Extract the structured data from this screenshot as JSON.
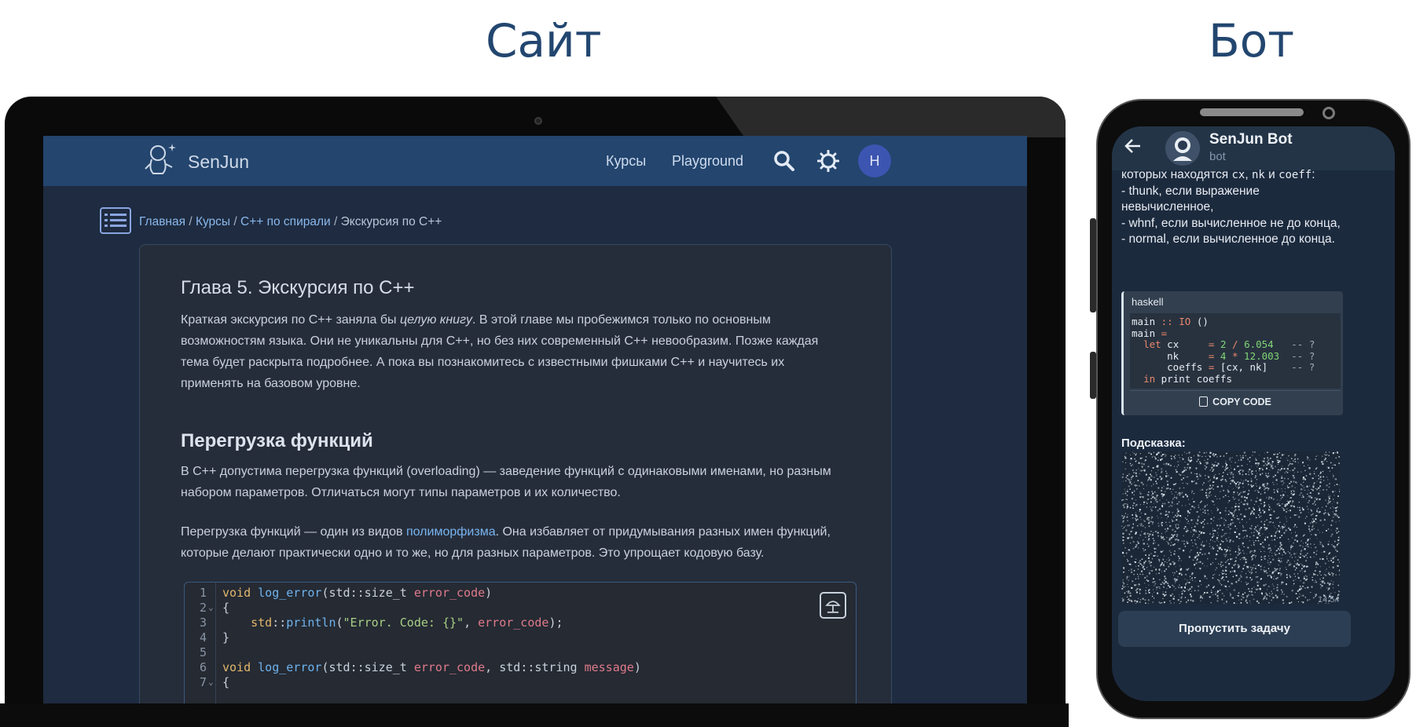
{
  "titles": {
    "site": "Сайт",
    "bot": "Бот"
  },
  "site": {
    "logo_text": "SenJun",
    "nav": {
      "courses": "Курсы",
      "playground": "Playground"
    },
    "avatar_initial": "Н",
    "breadcrumb": [
      "Главная",
      "Курсы",
      "C++ по спирали",
      "Экскурсия по C++"
    ],
    "breadcrumb_sep": "/",
    "chapter_title": "Глава 5. Экскурсия по C++",
    "intro": {
      "before": "Краткая экскурсия по C++ заняла бы ",
      "em": "целую книгу",
      "after": ". В этой главе мы пробежимся только по основным возможностям языка. Они не уникальны для C++, но без них современный C++ невообразим. Позже каждая тема будет раскрыта подробнее. А пока вы познакомитесь с известными фишками C++ и научитесь их применять на базовом уровне."
    },
    "section_title": "Перегрузка функций",
    "p1": "В C++ допустима перегрузка функций (overloading) — заведение функций с одинаковыми именами, но разным набором параметров. Отличаться могут типы параметров и их количество.",
    "p2": {
      "before": "Перегрузка функций — один из видов ",
      "link": "полиморфизма",
      "after": ". Она избавляет от придумывания разных имен функций, которые делают практически одно и то же, но для разных параметров. Это упрощает кодовую базу."
    },
    "code_line_numbers": [
      "1",
      "2",
      "3",
      "4",
      "5",
      "6",
      "7"
    ],
    "code_fold_marker": "⌄",
    "code_tokens": {
      "void": "void",
      "log_error": "log_error",
      "std": "std",
      "size_t": "size_t",
      "error_code": "error_code",
      "string": "string",
      "message": "message",
      "println": "println",
      "str": "\"Error. Code: {}\"",
      "open_brace": "{",
      "close_brace": "}"
    }
  },
  "bot": {
    "name": "SenJun Bot",
    "subtitle": "bot",
    "message": {
      "line1_before": "которых находятся ",
      "line1_cx": "cx",
      "line1_comma": ", ",
      "line1_nk": "nk",
      "line1_and": " и ",
      "line1_coeff": "coeff",
      "line1_colon": ":",
      "lines": [
        "- thunk, если выражение",
        "невычисленное,",
        "- whnf, если вычисленное не до конца,",
        "- normal, если вычисленное до конца."
      ]
    },
    "code_lang": "haskell",
    "haskell": {
      "main": "main",
      "dcolon": "::",
      "io": "IO",
      "unit": "()",
      "eq": "=",
      "let": "let",
      "in": "in",
      "cx": "cx",
      "nk": "nk",
      "coeffs": "coeffs",
      "n2": "2",
      "div": "/",
      "n6054": "6.054",
      "n4": "4",
      "mul": "*",
      "n12003": "12.003",
      "comment": "-- ?",
      "list": "[cx, nk]",
      "print": "print coeffs"
    },
    "copy_label": "COPY CODE",
    "hint_label": "Подсказка:",
    "time": "14:54",
    "skip_button": "Пропустить задачу"
  }
}
